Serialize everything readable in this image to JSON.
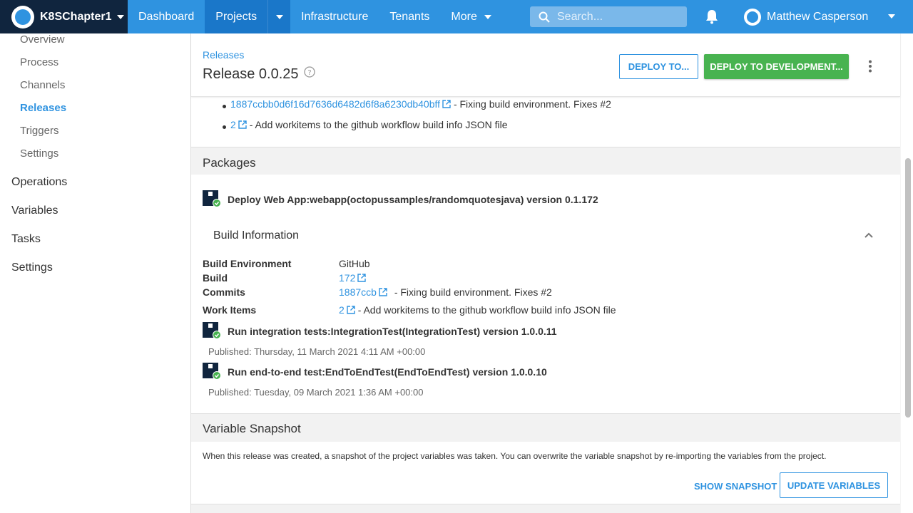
{
  "nav": {
    "space_name": "K8SChapter1",
    "items": {
      "dashboard": "Dashboard",
      "projects": "Projects",
      "infrastructure": "Infrastructure",
      "tenants": "Tenants",
      "more": "More"
    },
    "search_placeholder": "Search...",
    "user_name": "Matthew Casperson"
  },
  "sidebar": {
    "sub_items": [
      "Overview",
      "Process",
      "Channels",
      "Releases",
      "Triggers",
      "Settings"
    ],
    "main_items": [
      "Operations",
      "Variables",
      "Tasks",
      "Settings"
    ]
  },
  "header": {
    "breadcrumb": "Releases",
    "title": "Release 0.0.25",
    "deploy_to": "DEPLOY TO...",
    "deploy_dev": "DEPLOY TO DEVELOPMENT..."
  },
  "work_items": [
    {
      "link": "1887ccbb0d6f16d7636d6482d6f8a6230db40bff",
      "text": "- Fixing build environment. Fixes #2"
    },
    {
      "link": "2",
      "text": "- Add workitems to the github workflow build info JSON file"
    }
  ],
  "packages": {
    "heading": "Packages",
    "items": [
      {
        "title": "Deploy Web App:webapp(octopussamples/randomquotesjava) version 0.1.172"
      },
      {
        "title": "Run integration tests:IntegrationTest(IntegrationTest) version 1.0.0.11",
        "published": "Published: Thursday, 11 March 2021 4:11 AM +00:00"
      },
      {
        "title": "Run end-to-end test:EndToEndTest(EndToEndTest) version 1.0.0.10",
        "published": "Published: Tuesday, 09 March 2021 1:36 AM +00:00"
      }
    ],
    "build_info": {
      "heading": "Build Information",
      "labels": {
        "env": "Build Environment",
        "build": "Build",
        "commits": "Commits",
        "work_items": "Work Items"
      },
      "env": "GitHub",
      "build": "172",
      "commit_link": "1887ccb",
      "commit_text": "-  Fixing build environment. Fixes #2",
      "work_item_link": "2",
      "work_item_text": "- Add workitems to the github workflow build info JSON file"
    }
  },
  "variable_snapshot": {
    "heading": "Variable Snapshot",
    "description": "When this release was created, a snapshot of the project variables was taken. You can overwrite the variable snapshot by re-importing the variables from the project.",
    "show_snapshot": "SHOW SNAPSHOT",
    "update_variables": "UPDATE VARIABLES"
  },
  "colors": {
    "brand": "#2f93e0",
    "nav_dark": "#10253e",
    "success": "#48b350"
  }
}
